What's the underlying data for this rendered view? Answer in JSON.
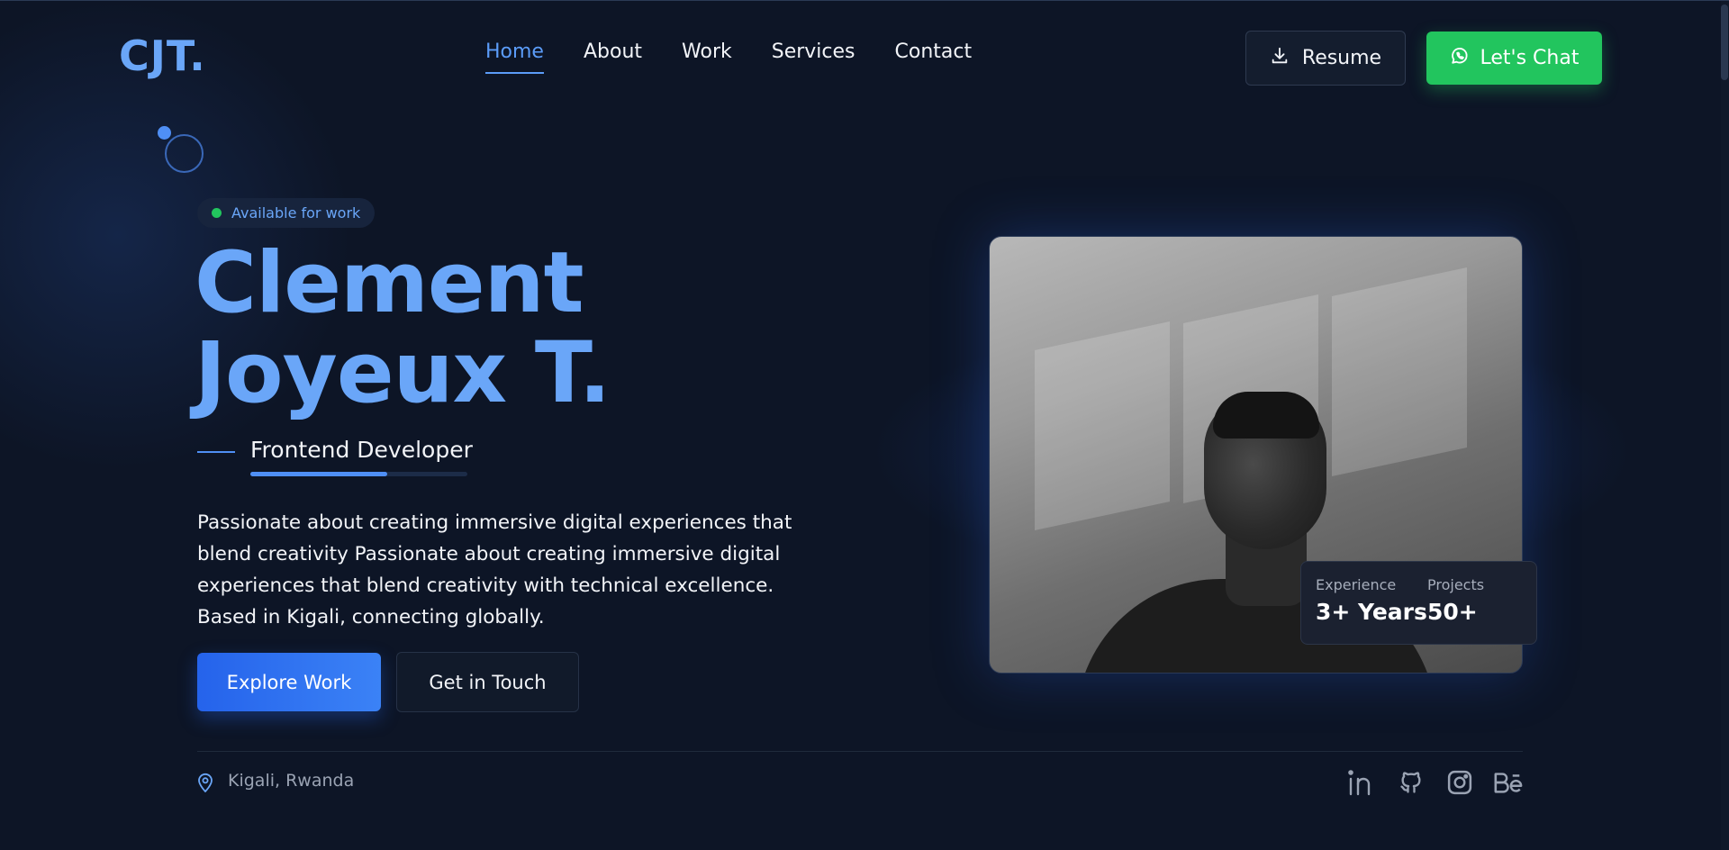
{
  "header": {
    "logo": "CJT.",
    "nav": [
      {
        "label": "Home",
        "active": true
      },
      {
        "label": "About",
        "active": false
      },
      {
        "label": "Work",
        "active": false
      },
      {
        "label": "Services",
        "active": false
      },
      {
        "label": "Contact",
        "active": false
      }
    ],
    "resume_label": "Resume",
    "chat_label": "Let's Chat"
  },
  "hero": {
    "badge": "Available for work",
    "name_line1": "Clement",
    "name_line2": "Joyeux T.",
    "role": "Frontend Developer",
    "role_progress_percent": 63,
    "description": "Passionate about creating immersive digital experiences that blend creativity Passionate about creating immersive digital experiences that blend creativity with technical excellence. Based in Kigali, connecting globally.",
    "explore_label": "Explore Work",
    "touch_label": "Get in Touch"
  },
  "stats": [
    {
      "label": "Experience",
      "value": "3+ Years"
    },
    {
      "label": "Projects",
      "value": "50+"
    }
  ],
  "footer": {
    "location": "Kigali, Rwanda",
    "socials": [
      {
        "icon": "linkedin-icon",
        "glyph": "in"
      },
      {
        "icon": "github-icon",
        "glyph": ""
      },
      {
        "icon": "instagram-icon",
        "glyph": ""
      },
      {
        "icon": "behance-icon",
        "glyph": "Bē"
      }
    ]
  },
  "colors": {
    "background": "#0d1526",
    "accent": "#5b9cf8",
    "chat_green": "#22c55e",
    "primary_blue": "#2563eb"
  }
}
